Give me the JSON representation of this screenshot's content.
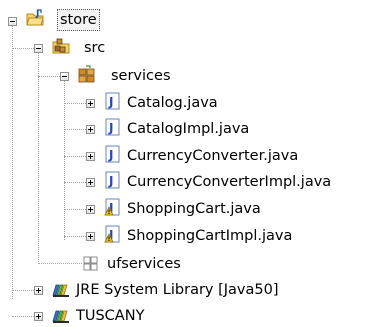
{
  "tree": {
    "project": {
      "label": "store",
      "icon": "java-project-icon",
      "expanded": true,
      "selected": true
    },
    "src_folder": {
      "label": "src",
      "icon": "source-folder-icon",
      "expanded": true
    },
    "package_services": {
      "label": "services",
      "icon": "package-icon",
      "expanded": true
    },
    "files": [
      {
        "label": "Catalog.java",
        "icon": "java-interface-icon"
      },
      {
        "label": "CatalogImpl.java",
        "icon": "java-interface-icon"
      },
      {
        "label": "CurrencyConverter.java",
        "icon": "java-interface-icon"
      },
      {
        "label": "CurrencyConverterImpl.java",
        "icon": "java-interface-icon"
      },
      {
        "label": "ShoppingCart.java",
        "icon": "java-file-warning-icon"
      },
      {
        "label": "ShoppingCartImpl.java",
        "icon": "java-file-warning-icon"
      }
    ],
    "package_ufservices": {
      "label": "ufservices",
      "icon": "empty-package-icon"
    },
    "libraries": [
      {
        "label": "JRE System Library [Java50]",
        "icon": "library-icon"
      },
      {
        "label": "TUSCANY",
        "icon": "library-icon"
      }
    ]
  }
}
